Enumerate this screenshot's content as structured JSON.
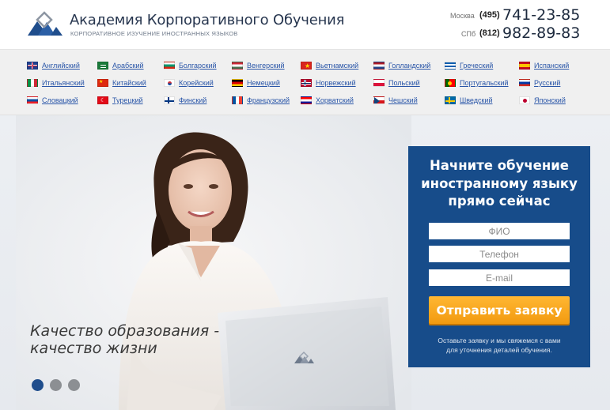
{
  "header": {
    "title": "Академия Корпоративного Обучения",
    "subtitle": "КОРПОРАТИВНОЕ ИЗУЧЕНИЕ ИНОСТРАННЫХ ЯЗЫКОВ",
    "phones": [
      {
        "city": "Москва",
        "code": "(495)",
        "number": "741-23-85"
      },
      {
        "city": "СПб",
        "code": "(812)",
        "number": "982-89-83"
      }
    ]
  },
  "languages": [
    {
      "label": "Английский",
      "flag": "uk-flag-icon"
    },
    {
      "label": "Арабский",
      "flag": "saudi-flag-icon"
    },
    {
      "label": "Болгарский",
      "flag": "bulgaria-flag-icon"
    },
    {
      "label": "Венгерский",
      "flag": "hungary-flag-icon"
    },
    {
      "label": "Вьетнамский",
      "flag": "vietnam-flag-icon"
    },
    {
      "label": "Голландский",
      "flag": "netherlands-flag-icon"
    },
    {
      "label": "Греческий",
      "flag": "greece-flag-icon"
    },
    {
      "label": "Испанский",
      "flag": "spain-flag-icon"
    },
    {
      "label": "Итальянский",
      "flag": "italy-flag-icon"
    },
    {
      "label": "Китайский",
      "flag": "china-flag-icon"
    },
    {
      "label": "Корейский",
      "flag": "korea-flag-icon"
    },
    {
      "label": "Немецкий",
      "flag": "germany-flag-icon"
    },
    {
      "label": "Норвежский",
      "flag": "norway-flag-icon"
    },
    {
      "label": "Польский",
      "flag": "poland-flag-icon"
    },
    {
      "label": "Португальский",
      "flag": "portugal-flag-icon"
    },
    {
      "label": "Русский",
      "flag": "russia-flag-icon"
    },
    {
      "label": "Словацкий",
      "flag": "slovakia-flag-icon"
    },
    {
      "label": "Турецкий",
      "flag": "turkey-flag-icon"
    },
    {
      "label": "Финский",
      "flag": "finland-flag-icon"
    },
    {
      "label": "Французский",
      "flag": "france-flag-icon"
    },
    {
      "label": "Хорватский",
      "flag": "croatia-flag-icon"
    },
    {
      "label": "Чешский",
      "flag": "czech-flag-icon"
    },
    {
      "label": "Шведский",
      "flag": "sweden-flag-icon"
    },
    {
      "label": "Японский",
      "flag": "japan-flag-icon"
    }
  ],
  "hero": {
    "slogan_line1": "Качество образования -",
    "slogan_line2": "качество жизни",
    "slides_total": 3,
    "active_slide": 1
  },
  "form": {
    "title_line1": "Начните обучение",
    "title_line2": "иностранному языку",
    "title_line3": "прямо сейчас",
    "name_placeholder": "ФИО",
    "phone_placeholder": "Телефон",
    "email_placeholder": "E-mail",
    "submit_label": "Отправить заявку",
    "note_line1": "Оставьте заявку и мы свяжемся с вами",
    "note_line2": "для уточнения деталей обучения."
  },
  "colors": {
    "brand_blue": "#174c8a",
    "button_orange": "#f29a0f",
    "link_blue": "#2a56a8"
  }
}
